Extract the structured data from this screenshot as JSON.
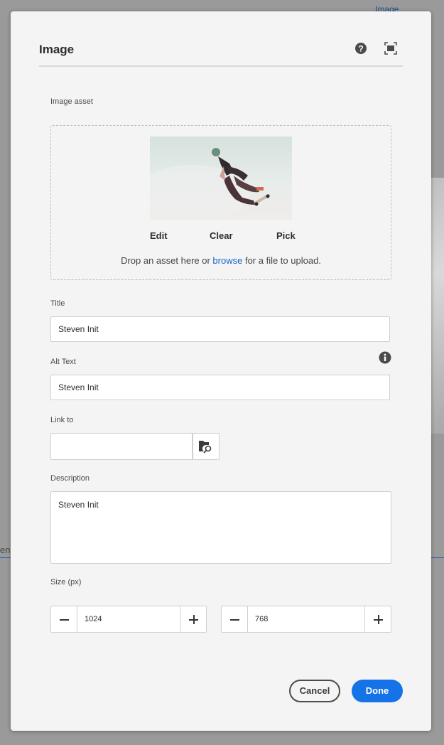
{
  "background": {
    "link_text": "Image",
    "left_text": "en"
  },
  "dialog": {
    "title": "Image",
    "icons": {
      "help": "help-icon",
      "fullscreen": "fullscreen-icon"
    }
  },
  "image_asset": {
    "label": "Image asset",
    "actions": {
      "edit": "Edit",
      "clear": "Clear",
      "pick": "Pick"
    },
    "drop_prefix": "Drop an asset here or ",
    "drop_link": "browse",
    "drop_suffix": " for a file to upload."
  },
  "title_field": {
    "label": "Title",
    "value": "Steven Init"
  },
  "alt_field": {
    "label": "Alt Text",
    "value": "Steven Init",
    "icon": "info-icon"
  },
  "link_field": {
    "label": "Link to",
    "value": "",
    "icon": "folder-search-icon"
  },
  "description_field": {
    "label": "Description",
    "value": "Steven Init"
  },
  "size": {
    "label": "Size (px)",
    "width": "1024",
    "height": "768"
  },
  "footer": {
    "cancel": "Cancel",
    "done": "Done"
  },
  "colors": {
    "accent": "#1473e6",
    "link": "#1467c8",
    "dialog_bg": "#f4f4f4"
  }
}
